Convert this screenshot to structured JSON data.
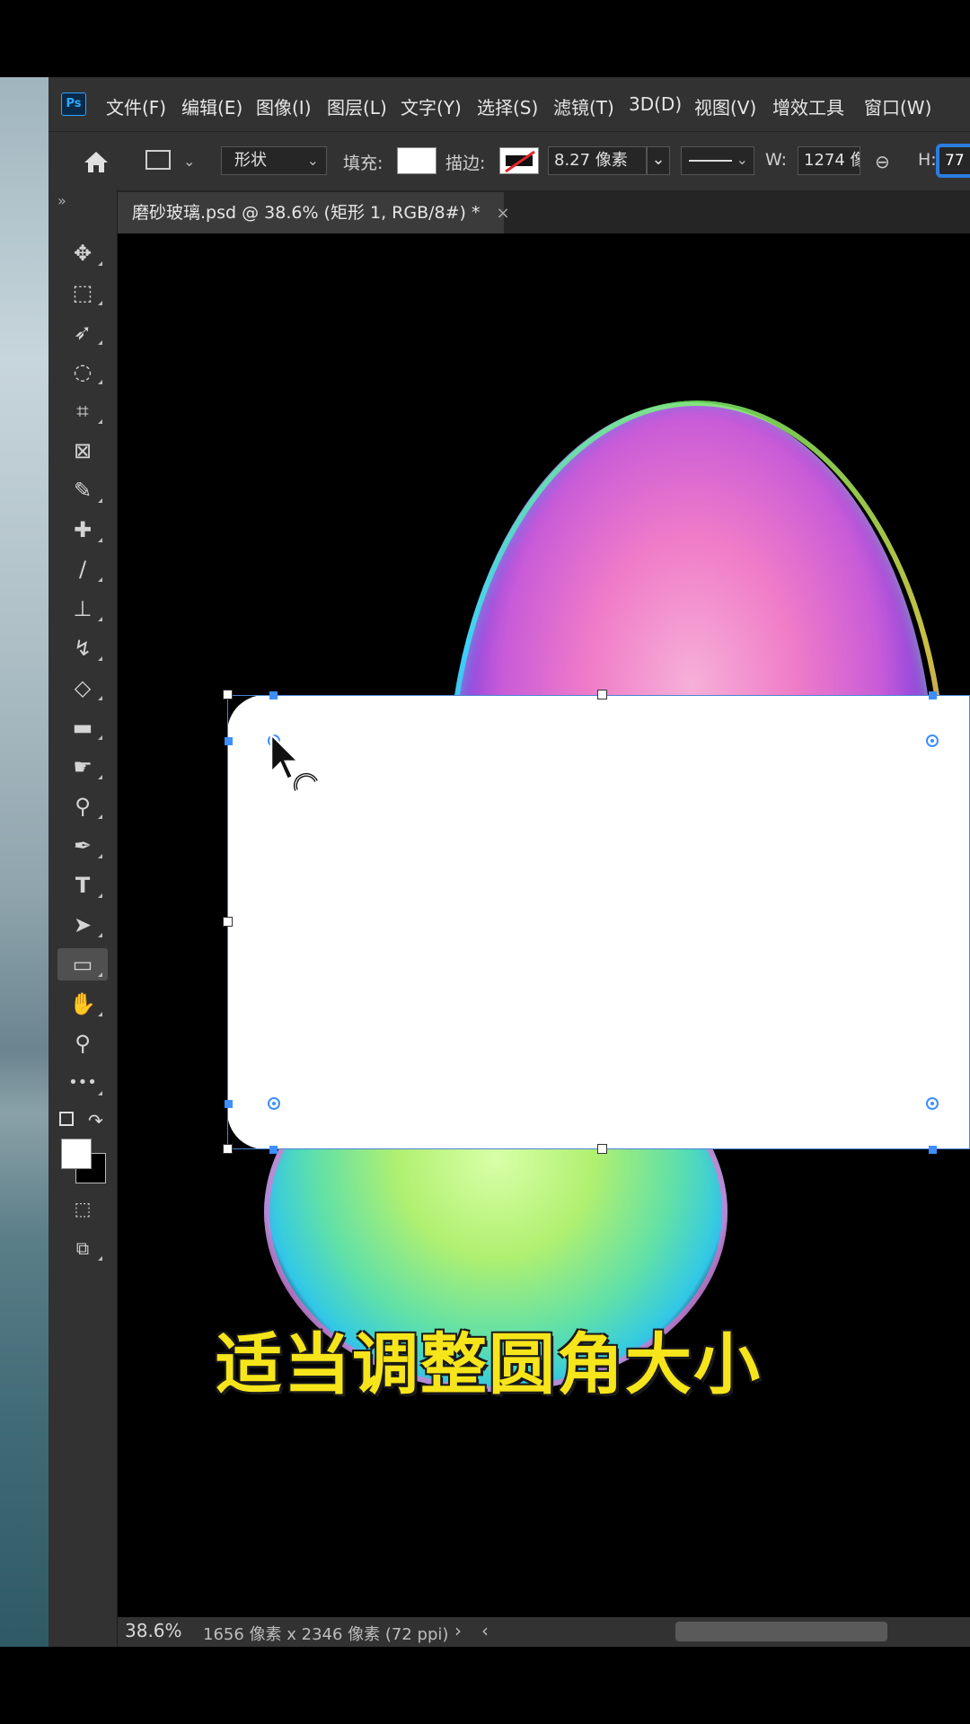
{
  "app": {
    "logo": "Ps"
  },
  "menu": [
    "文件(F)",
    "编辑(E)",
    "图像(I)",
    "图层(L)",
    "文字(Y)",
    "选择(S)",
    "滤镜(T)",
    "3D(D)",
    "视图(V)",
    "增效工具",
    "窗口(W)"
  ],
  "options": {
    "mode_value": "形状",
    "fill_label": "填充:",
    "stroke_label": "描边:",
    "stroke_width": "8.27 像素",
    "w_label": "W:",
    "w_value": "1274 像",
    "h_label": "H:",
    "h_value": "77"
  },
  "document": {
    "tab_title": "磨砂玻璃.psd @ 38.6% (矩形 1, RGB/8#) *",
    "close_glyph": "×"
  },
  "tools": [
    {
      "name": "move-tool-icon",
      "glyph": "✥"
    },
    {
      "name": "rect-marquee-tool-icon",
      "glyph": "⬚"
    },
    {
      "name": "lasso-tool-icon",
      "glyph": "➶"
    },
    {
      "name": "quick-select-tool-icon",
      "glyph": "◌"
    },
    {
      "name": "crop-tool-icon",
      "glyph": "⌗"
    },
    {
      "name": "frame-tool-icon",
      "glyph": "⊠"
    },
    {
      "name": "eyedropper-tool-icon",
      "glyph": "✎"
    },
    {
      "name": "healing-brush-tool-icon",
      "glyph": "✚"
    },
    {
      "name": "brush-tool-icon",
      "glyph": "∕"
    },
    {
      "name": "stamp-tool-icon",
      "glyph": "⊥"
    },
    {
      "name": "history-brush-tool-icon",
      "glyph": "↯"
    },
    {
      "name": "eraser-tool-icon",
      "glyph": "◇"
    },
    {
      "name": "gradient-tool-icon",
      "glyph": "▬"
    },
    {
      "name": "smudge-tool-icon",
      "glyph": "☛"
    },
    {
      "name": "dodge-tool-icon",
      "glyph": "⚲"
    },
    {
      "name": "pen-tool-icon",
      "glyph": "✒"
    },
    {
      "name": "type-tool-icon",
      "glyph": "T"
    },
    {
      "name": "path-select-tool-icon",
      "glyph": "➤"
    },
    {
      "name": "rectangle-tool-icon",
      "glyph": "▭"
    },
    {
      "name": "hand-tool-icon",
      "glyph": "✋"
    },
    {
      "name": "zoom-tool-icon",
      "glyph": "⚲"
    },
    {
      "name": "more-tools-icon",
      "glyph": "•••"
    }
  ],
  "caption": "适当调整圆角大小",
  "status": {
    "zoom": "38.6%",
    "doc_size": "1656 像素 x 2346 像素 (72 ppi)",
    "arrow_right": "›",
    "arrow_left": "‹"
  },
  "colors": {
    "accent": "#3d8eff",
    "caption": "#f7e51b"
  }
}
